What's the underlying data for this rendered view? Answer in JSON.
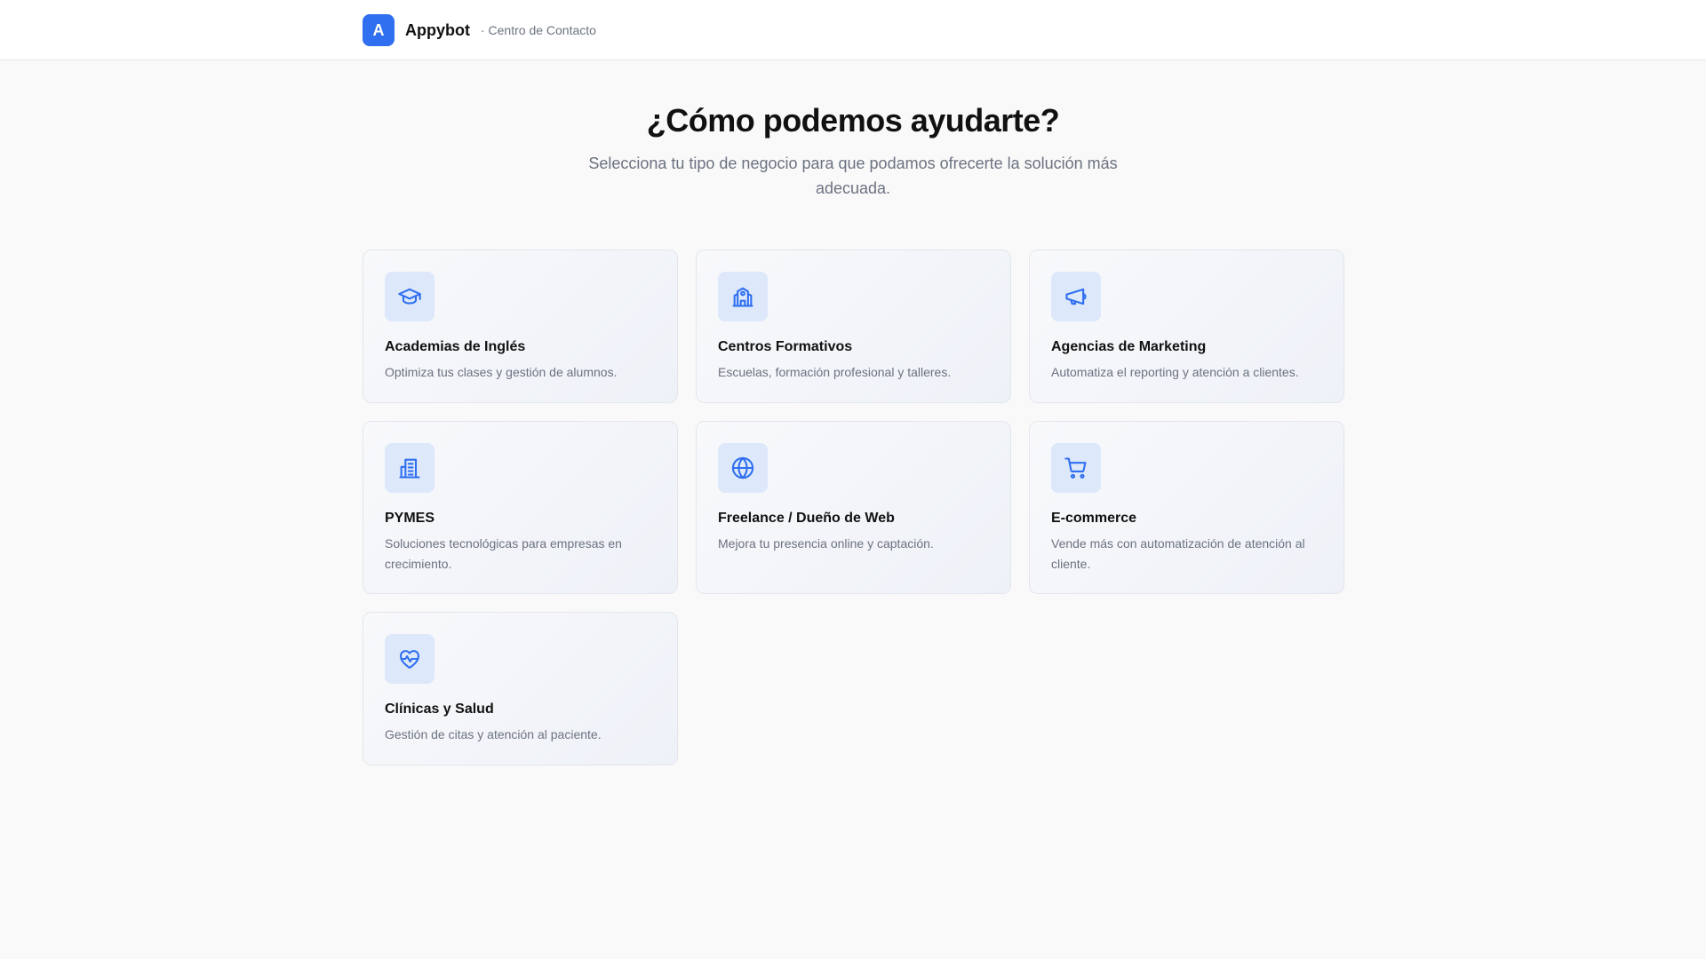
{
  "header": {
    "logo_letter": "A",
    "brand_name": "Appybot",
    "subtitle": "· Centro de Contacto",
    "accent_color": "#2f6ff0"
  },
  "hero": {
    "title": "¿Cómo podemos ayudarte?",
    "description": "Selecciona tu tipo de negocio para que podamos ofrecerte la solución más adecuada."
  },
  "cards": [
    {
      "icon": "graduation-cap-icon",
      "title": "Academias de Inglés",
      "description": "Optimiza tus clases y gestión de alumnos."
    },
    {
      "icon": "school-building-icon",
      "title": "Centros Formativos",
      "description": "Escuelas, formación profesional y talleres."
    },
    {
      "icon": "megaphone-icon",
      "title": "Agencias de Marketing",
      "description": "Automatiza el reporting y atención a clientes."
    },
    {
      "icon": "office-building-icon",
      "title": "PYMES",
      "description": "Soluciones tecnológicas para empresas en crecimiento."
    },
    {
      "icon": "globe-icon",
      "title": "Freelance / Dueño de Web",
      "description": "Mejora tu presencia online y captación."
    },
    {
      "icon": "shopping-cart-icon",
      "title": "E-commerce",
      "description": "Vende más con automatización de atención al cliente."
    },
    {
      "icon": "heart-pulse-icon",
      "title": "Clínicas y Salud",
      "description": "Gestión de citas y atención al paciente."
    }
  ]
}
